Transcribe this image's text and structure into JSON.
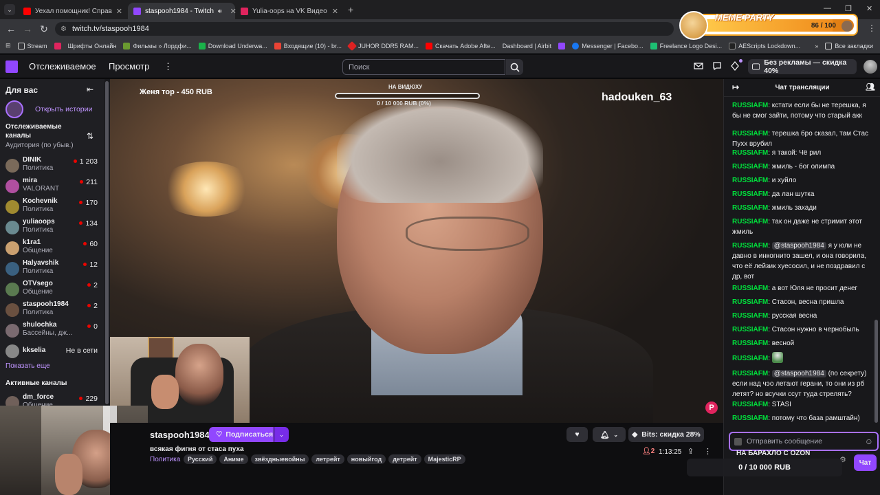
{
  "browser": {
    "tabs": [
      {
        "title": "Уехал помощник! Справляем...",
        "favicon_color": "#ff0000"
      },
      {
        "title": "staspooh1984 - Twitch",
        "favicon_color": "#9147ff"
      },
      {
        "title": "Yulia-oops на VK Видео Live -...",
        "favicon_color": "#e0245e"
      }
    ],
    "url": "twitch.tv/staspooh1984",
    "bookmarks": [
      "Stream",
      "Шрифты Онлайн",
      "Фильмы » Лордфи...",
      "Download Underwa...",
      "Входящие (10) - br...",
      "JUHOR DDR5 RAM...",
      "Скачать Adobe Afte...",
      "Dashboard | Airbit",
      "Messenger | Facebo...",
      "Freelance Logo Desi...",
      "AEScripts Lockdown...",
      "Все закладки"
    ]
  },
  "meme_party": {
    "title": "MEME PARTY",
    "count": "86 / 100",
    "progress": 0.86
  },
  "topnav": {
    "following": "Отслеживаемое",
    "browse": "Просмотр",
    "search_placeholder": "Поиск",
    "promo": "Без рекламы — скидка 40%"
  },
  "sidebar": {
    "for_you": "Для вас",
    "open_stories": "Открыть истории",
    "followed_title_1": "Отслеживаемые",
    "followed_title_2": "каналы",
    "sort": "Аудитория (по убыв.)",
    "channels": [
      {
        "name": "DINIK",
        "category": "Политика",
        "viewers": "1 203",
        "live": true,
        "color": "#7a6a5a"
      },
      {
        "name": "mira",
        "category": "VALORANT",
        "viewers": "211",
        "live": true,
        "color": "#b04fa0"
      },
      {
        "name": "Kochevnik",
        "category": "Политика",
        "viewers": "170",
        "live": true,
        "color": "#a08a30"
      },
      {
        "name": "yuliaoops",
        "category": "Политика",
        "viewers": "134",
        "live": true,
        "color": "#6a8a90"
      },
      {
        "name": "k1ra1",
        "category": "Общение",
        "viewers": "60",
        "live": true,
        "color": "#caa070"
      },
      {
        "name": "Halyavshik",
        "category": "Политика",
        "viewers": "12",
        "live": true,
        "color": "#3a6080"
      },
      {
        "name": "OTVsego",
        "category": "Общение",
        "viewers": "2",
        "live": true,
        "color": "#5a7a50"
      },
      {
        "name": "staspooh1984",
        "category": "Политика",
        "viewers": "2",
        "live": true,
        "color": "#6a5040"
      },
      {
        "name": "shulochka",
        "category": "Бассейны, дж...",
        "viewers": "0",
        "live": true,
        "color": "#7a6a70"
      },
      {
        "name": "kkselia",
        "category": "",
        "viewers": "Не в сети",
        "live": false,
        "color": "#888888"
      }
    ],
    "show_more": "Показать еще",
    "active_title": "Активные каналы",
    "active": [
      {
        "name": "dm_force",
        "category": "Общение",
        "viewers": "229",
        "live": true,
        "color": "#70605a"
      }
    ]
  },
  "video": {
    "donation": "Женя тор - 450 RUB",
    "goal_title": "НА ВИДЮХУ",
    "goal_value": "0 / 10 000 RUB (0%)",
    "goal_progress": 0.0,
    "handle": "hadouken_63"
  },
  "stream": {
    "channel": "staspooh1984",
    "follow_label": "Подписаться",
    "title": "всякая фигня от стаса пуха",
    "category": "Политика",
    "tags": [
      "Русский",
      "Аниме",
      "звёздныевойны",
      "летрейт",
      "новыйгод",
      "детрейт",
      "MajesticRP"
    ],
    "bits_label": "Bits: скидка 28%",
    "viewers": "2",
    "uptime": "1:13:25"
  },
  "chat": {
    "header": "Чат трансляции",
    "messages": [
      {
        "user": "RUSSIAFM",
        "mention": "",
        "text": "кстати если бы не терешка, я бы не смог зайти, потому что старый акк"
      },
      {
        "user": "RUSSIAFM",
        "mention": "",
        "text": "терешка бро сказал, там Стас Пухх врубил"
      },
      {
        "user": "RUSSIAFM",
        "mention": "",
        "text": "я такой: Чё рил"
      },
      {
        "user": "RUSSIAFM",
        "mention": "",
        "text": "жмиль - бог олимпа"
      },
      {
        "user": "RUSSIAFM",
        "mention": "",
        "text": "и хуйло"
      },
      {
        "user": "RUSSIAFM",
        "mention": "",
        "text": "да лан шутка"
      },
      {
        "user": "RUSSIAFM",
        "mention": "",
        "text": "жмиль захади"
      },
      {
        "user": "RUSSIAFM",
        "mention": "",
        "text": "так он даже не стримит этот жмиль"
      },
      {
        "user": "RUSSIAFM",
        "mention": "@staspooh1984",
        "text": "я у юли не давно в инкогнито зашел, и она говорила, что её лейзик хуесосил, и не поздравил с др, вот"
      },
      {
        "user": "RUSSIAFM",
        "mention": "",
        "text": "а вот Юля не просит денег"
      },
      {
        "user": "RUSSIAFM",
        "mention": "",
        "text": "Стасон, весна пришла"
      },
      {
        "user": "RUSSIAFM",
        "mention": "",
        "text": "русская весна"
      },
      {
        "user": "RUSSIAFM",
        "mention": "",
        "text": "Стасон нужно в чернобыль"
      },
      {
        "user": "RUSSIAFM",
        "mention": "",
        "text": "весной"
      },
      {
        "user": "RUSSIAFM",
        "mention": "",
        "text": ""
      },
      {
        "user": "RUSSIAFM",
        "mention": "@staspooh1984",
        "text": "(по секрету) если над чэо летают герани, то они из рб летят? но всучки ссут туда стрелять?"
      },
      {
        "user": "RUSSIAFM",
        "mention": "",
        "text": "STASI"
      },
      {
        "user": "RUSSIAFM",
        "mention": "",
        "text": "потому что база рамштайн)"
      }
    ],
    "input_placeholder": "Отправить сообщение",
    "ad_banner": "НА БАРАХЛО С OZON",
    "goal": "0 / 10 000 RUB",
    "send_label": "Чат"
  }
}
